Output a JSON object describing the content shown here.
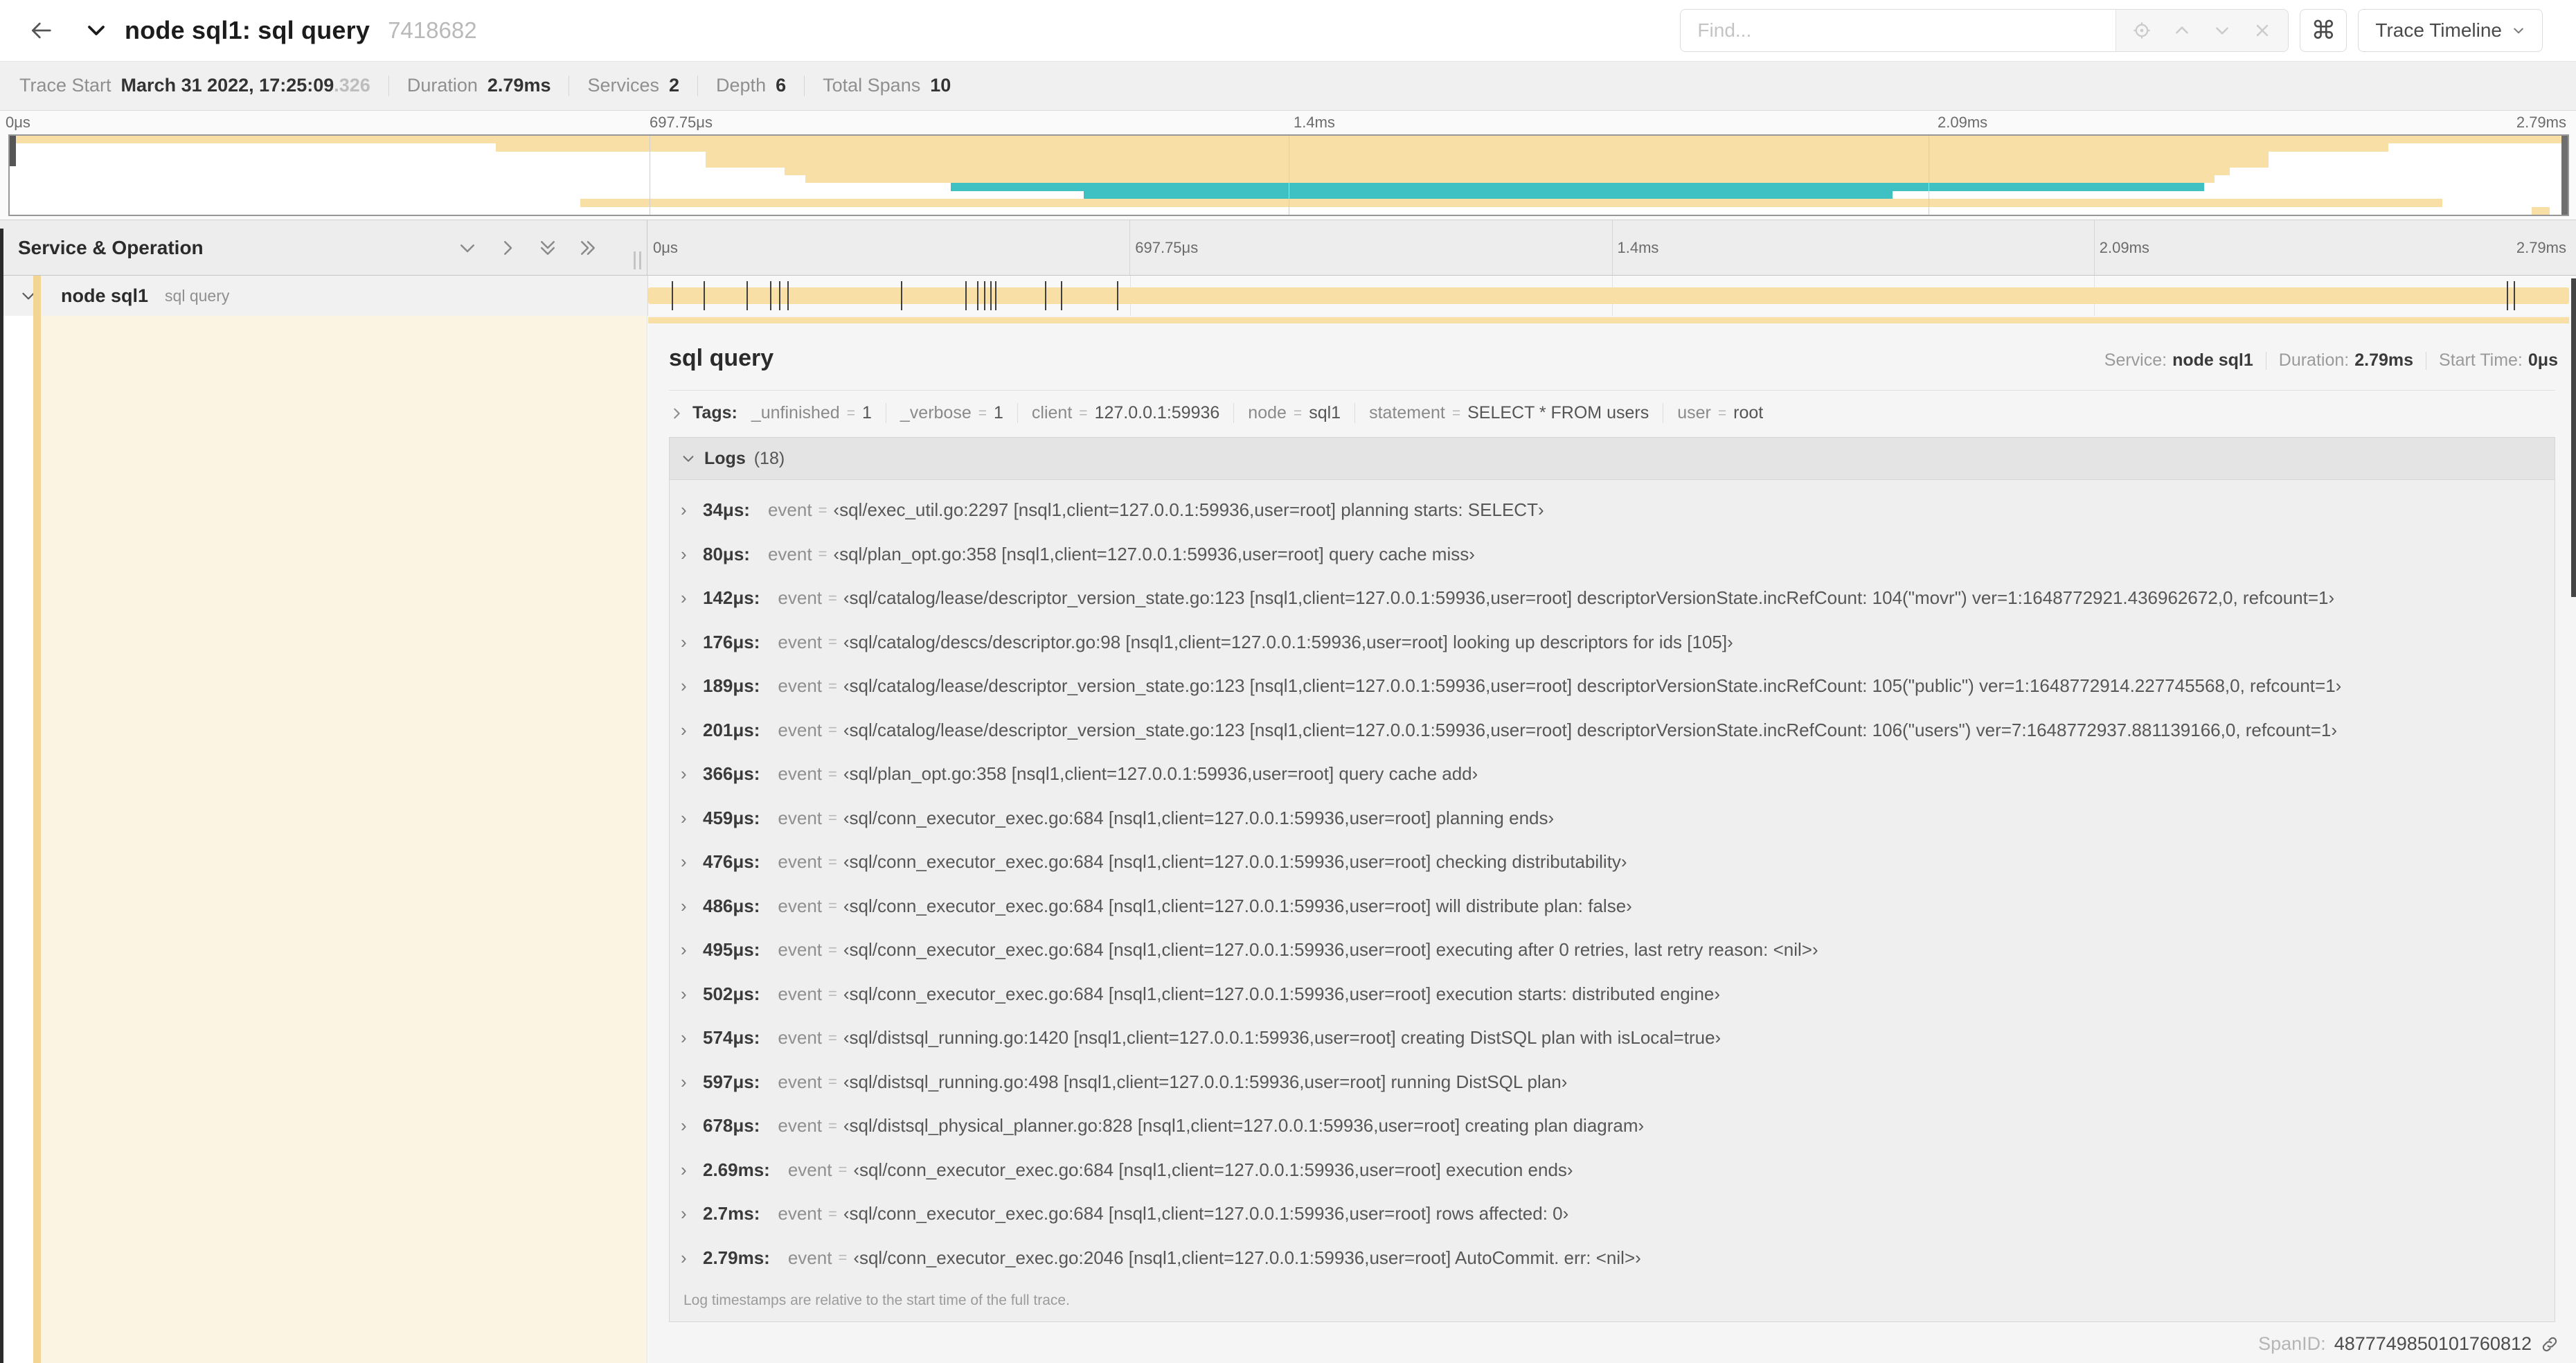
{
  "header": {
    "title": "node sql1: sql query",
    "trace_id": "7418682",
    "find_placeholder": "Find...",
    "command_glyph": "⌘",
    "view_button": "Trace Timeline"
  },
  "summary": {
    "trace_start_label": "Trace Start",
    "trace_start": "March 31 2022, 17:25:09",
    "trace_start_fraction": ".326",
    "duration_label": "Duration",
    "duration": "2.79ms",
    "services_label": "Services",
    "services": "2",
    "depth_label": "Depth",
    "depth": "6",
    "total_spans_label": "Total Spans",
    "total_spans": "10"
  },
  "timeline": {
    "duration_us": 2790,
    "ticks": [
      {
        "label": "0μs",
        "pos": 0
      },
      {
        "label": "697.75μs",
        "pos": 25
      },
      {
        "label": "1.4ms",
        "pos": 50
      },
      {
        "label": "2.09ms",
        "pos": 75
      },
      {
        "label": "2.79ms",
        "pos": 100
      }
    ]
  },
  "minimap": {
    "spans": [
      {
        "start": 0.0,
        "end": 1.0,
        "color": "tan"
      },
      {
        "start": 0.19,
        "end": 0.93,
        "color": "tan"
      },
      {
        "start": 0.272,
        "end": 0.883,
        "color": "tan"
      },
      {
        "start": 0.272,
        "end": 0.883,
        "color": "tan"
      },
      {
        "start": 0.303,
        "end": 0.868,
        "color": "tan"
      },
      {
        "start": 0.311,
        "end": 0.862,
        "color": "tan"
      },
      {
        "start": 0.368,
        "end": 0.858,
        "color": "teal"
      },
      {
        "start": 0.42,
        "end": 0.736,
        "color": "teal"
      },
      {
        "start": 0.223,
        "end": 0.951,
        "color": "tan"
      },
      {
        "start": 0.986,
        "end": 0.993,
        "color": "tan"
      }
    ]
  },
  "table_header": {
    "title": "Service & Operation"
  },
  "span_row": {
    "service": "node sql1",
    "operation": "sql query"
  },
  "detail": {
    "title": "sql query",
    "service_label": "Service:",
    "service": "node sql1",
    "duration_label": "Duration:",
    "duration": "2.79ms",
    "start_label": "Start Time:",
    "start": "0μs",
    "tags_label": "Tags:",
    "tags": [
      {
        "key": "_unfinished",
        "value": "1"
      },
      {
        "key": "_verbose",
        "value": "1"
      },
      {
        "key": "client",
        "value": "127.0.0.1:59936"
      },
      {
        "key": "node",
        "value": "sql1"
      },
      {
        "key": "statement",
        "value": "SELECT * FROM users"
      },
      {
        "key": "user",
        "value": "root"
      }
    ],
    "logs_label": "Logs",
    "logs_count": "(18)",
    "logs": [
      {
        "time": "34μs",
        "us": 34,
        "text": "sql/exec_util.go:2297 [nsql1,client=127.0.0.1:59936,user=root] planning starts: SELECT"
      },
      {
        "time": "80μs",
        "us": 80,
        "text": "sql/plan_opt.go:358 [nsql1,client=127.0.0.1:59936,user=root] query cache miss"
      },
      {
        "time": "142μs",
        "us": 142,
        "text": "sql/catalog/lease/descriptor_version_state.go:123 [nsql1,client=127.0.0.1:59936,user=root] descriptorVersionState.incRefCount: 104(\"movr\") ver=1:1648772921.436962672,0, refcount=1"
      },
      {
        "time": "176μs",
        "us": 176,
        "text": "sql/catalog/descs/descriptor.go:98 [nsql1,client=127.0.0.1:59936,user=root] looking up descriptors for ids [105]"
      },
      {
        "time": "189μs",
        "us": 189,
        "text": "sql/catalog/lease/descriptor_version_state.go:123 [nsql1,client=127.0.0.1:59936,user=root] descriptorVersionState.incRefCount: 105(\"public\") ver=1:1648772914.227745568,0, refcount=1"
      },
      {
        "time": "201μs",
        "us": 201,
        "text": "sql/catalog/lease/descriptor_version_state.go:123 [nsql1,client=127.0.0.1:59936,user=root] descriptorVersionState.incRefCount: 106(\"users\") ver=7:1648772937.881139166,0, refcount=1"
      },
      {
        "time": "366μs",
        "us": 366,
        "text": "sql/plan_opt.go:358 [nsql1,client=127.0.0.1:59936,user=root] query cache add"
      },
      {
        "time": "459μs",
        "us": 459,
        "text": "sql/conn_executor_exec.go:684 [nsql1,client=127.0.0.1:59936,user=root] planning ends"
      },
      {
        "time": "476μs",
        "us": 476,
        "text": "sql/conn_executor_exec.go:684 [nsql1,client=127.0.0.1:59936,user=root] checking distributability"
      },
      {
        "time": "486μs",
        "us": 486,
        "text": "sql/conn_executor_exec.go:684 [nsql1,client=127.0.0.1:59936,user=root] will distribute plan: false"
      },
      {
        "time": "495μs",
        "us": 495,
        "text": "sql/conn_executor_exec.go:684 [nsql1,client=127.0.0.1:59936,user=root] executing after 0 retries, last retry reason: <nil>"
      },
      {
        "time": "502μs",
        "us": 502,
        "text": "sql/conn_executor_exec.go:684 [nsql1,client=127.0.0.1:59936,user=root] execution starts: distributed engine"
      },
      {
        "time": "574μs",
        "us": 574,
        "text": "sql/distsql_running.go:1420 [nsql1,client=127.0.0.1:59936,user=root] creating DistSQL plan with isLocal=true"
      },
      {
        "time": "597μs",
        "us": 597,
        "text": "sql/distsql_running.go:498 [nsql1,client=127.0.0.1:59936,user=root] running DistSQL plan"
      },
      {
        "time": "678μs",
        "us": 678,
        "text": "sql/distsql_physical_planner.go:828 [nsql1,client=127.0.0.1:59936,user=root] creating plan diagram"
      },
      {
        "time": "2.69ms",
        "us": 2690,
        "text": "sql/conn_executor_exec.go:684 [nsql1,client=127.0.0.1:59936,user=root] execution ends"
      },
      {
        "time": "2.7ms",
        "us": 2700,
        "text": "sql/conn_executor_exec.go:684 [nsql1,client=127.0.0.1:59936,user=root] rows affected: 0"
      },
      {
        "time": "2.79ms",
        "us": 2790,
        "text": "sql/conn_executor_exec.go:2046 [nsql1,client=127.0.0.1:59936,user=root] AutoCommit. err: <nil>"
      }
    ],
    "logs_footer": "Log timestamps are relative to the start time of the full trace.",
    "span_id_label": "SpanID:",
    "span_id": "4877749850101760812"
  },
  "colors": {
    "tan": "#f8dfa6",
    "tan_strip": "#f2d493",
    "teal": "#3fc0c2",
    "cream": "#fcf4e2"
  }
}
